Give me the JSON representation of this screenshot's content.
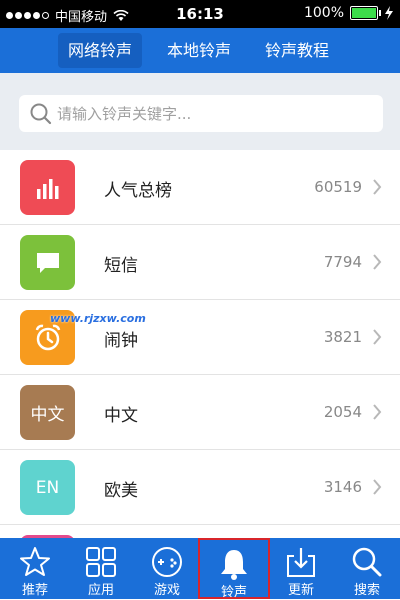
{
  "status_bar": {
    "carrier": "中国移动",
    "time": "16:13",
    "battery": "100%"
  },
  "top_tabs": [
    {
      "label": "网络铃声"
    },
    {
      "label": "本地铃声"
    },
    {
      "label": "铃声教程"
    }
  ],
  "search": {
    "placeholder": "请输入铃声关键字..."
  },
  "list": [
    {
      "label": "人气总榜",
      "count": "60519",
      "icon": "bar-chart-icon",
      "color": "#ef4b55"
    },
    {
      "label": "短信",
      "count": "7794",
      "icon": "chat-bubble-icon",
      "color": "#7cc13b"
    },
    {
      "label": "闹钟",
      "count": "3821",
      "icon": "alarm-clock-icon",
      "color": "#f79b1e"
    },
    {
      "label": "中文",
      "count": "2054",
      "icon_text": "中文",
      "color": "#a77b52"
    },
    {
      "label": "欧美",
      "count": "3146",
      "icon_text": "EN",
      "color": "#5fd3cf"
    }
  ],
  "watermark": "www.rjzxw.com",
  "bottom_nav": [
    {
      "label": "推荐",
      "icon": "star-icon"
    },
    {
      "label": "应用",
      "icon": "grid-icon"
    },
    {
      "label": "游戏",
      "icon": "gamepad-icon"
    },
    {
      "label": "铃声",
      "icon": "bell-icon",
      "active": true
    },
    {
      "label": "更新",
      "icon": "download-icon"
    },
    {
      "label": "搜索",
      "icon": "search-icon"
    }
  ]
}
